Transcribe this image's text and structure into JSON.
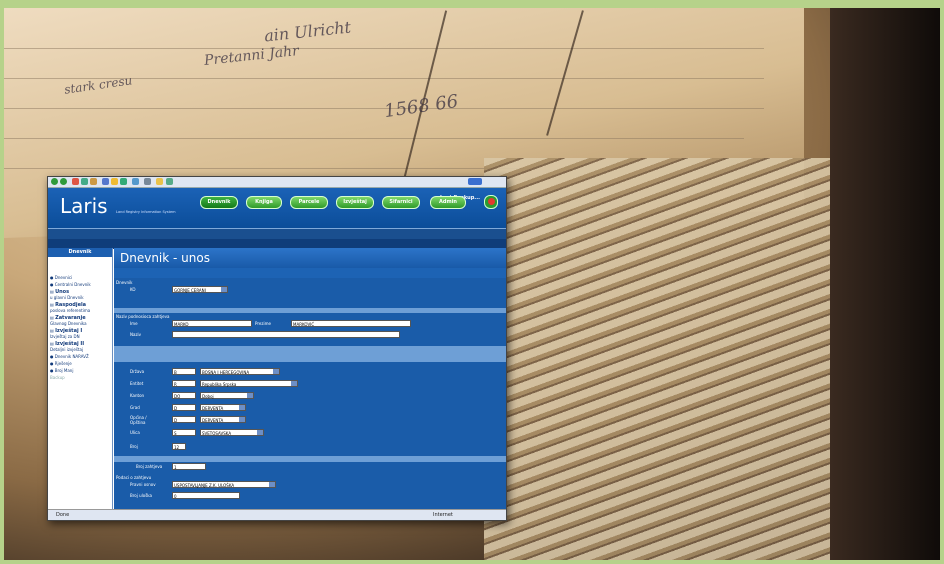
{
  "window": {
    "last_backup": "Last Backup..."
  },
  "logo": {
    "text": "Laris",
    "tagline": "Land Registry Information System"
  },
  "nav": [
    {
      "label": "Dnevnik",
      "active": true
    },
    {
      "label": "Knjiga",
      "active": false
    },
    {
      "label": "Parcele",
      "active": false
    },
    {
      "label": "Izvještaj",
      "active": false
    },
    {
      "label": "Sifarnici",
      "active": false
    },
    {
      "label": "Admin",
      "active": false
    }
  ],
  "sidebar": {
    "title": "Dnevnik",
    "items": [
      {
        "label": "Dnevnici"
      },
      {
        "label": "Centralni Dnevnik"
      },
      {
        "label": "Unos",
        "sub": "u glavni Dnevnik"
      },
      {
        "label": "Raspodjela",
        "sub": "poslova referentima"
      },
      {
        "label": "Zatvaranje",
        "sub": "Glavnog Dnevnika"
      },
      {
        "label": "Izvještaj I",
        "sub": "Izvještaj za DN"
      },
      {
        "label": "Izvještaj II",
        "sub": "Detaljni izvještaj"
      },
      {
        "label": "Dnevnik NARAVŽ"
      },
      {
        "label": "Rješenje"
      },
      {
        "label": "Broj Manj"
      },
      {
        "label": "Backup"
      }
    ]
  },
  "main": {
    "title": "Dnevnik - unos",
    "sec1": "Dnevnik",
    "ko_label": "KO",
    "ko_value": "GORNJE CERANI",
    "sec2": "Naziv podnosioca zahtjeva",
    "ime_label": "Ime",
    "ime_value": "MARKO",
    "prezime_label": "Prezime",
    "prezime_value": "MARKOVIĆ",
    "naziv_label": "Naziv",
    "drzava_label": "Država",
    "drzava_code": "B",
    "drzava_value": "BOSNA I HERCEGOVINA",
    "entitet_label": "Entitet",
    "entitet_code": "R",
    "entitet_value": "Republika Srpska",
    "kanton_label": "Kanton",
    "kanton_code": "DO",
    "kanton_value": "Doboj",
    "grad_label": "Grad",
    "grad_code": "D",
    "grad_value": "DERVENTA",
    "opcina_label": "Općina / Opština",
    "opcina_code": "D",
    "opcina_value": "DERVENTA",
    "ulica_label": "Ulica",
    "ulica_code": "S",
    "ulica_value": "SVETOSAVSKA",
    "broj_label": "Broj",
    "broj_value": "12",
    "brojz_label": "Broj zahtjeva",
    "brojz_value": "1",
    "sec3": "Podaci o zahtjevu",
    "pravni_label": "Pravni osnov",
    "pravni_value": "USPOSTAVLJANJE Z.K. ULOŠKA",
    "brojul_label": "Broj uloška",
    "brojul_value": "0"
  },
  "status": {
    "left": "Done",
    "right": "Internet"
  },
  "background": {
    "ledger_numbers": "1568   66"
  }
}
